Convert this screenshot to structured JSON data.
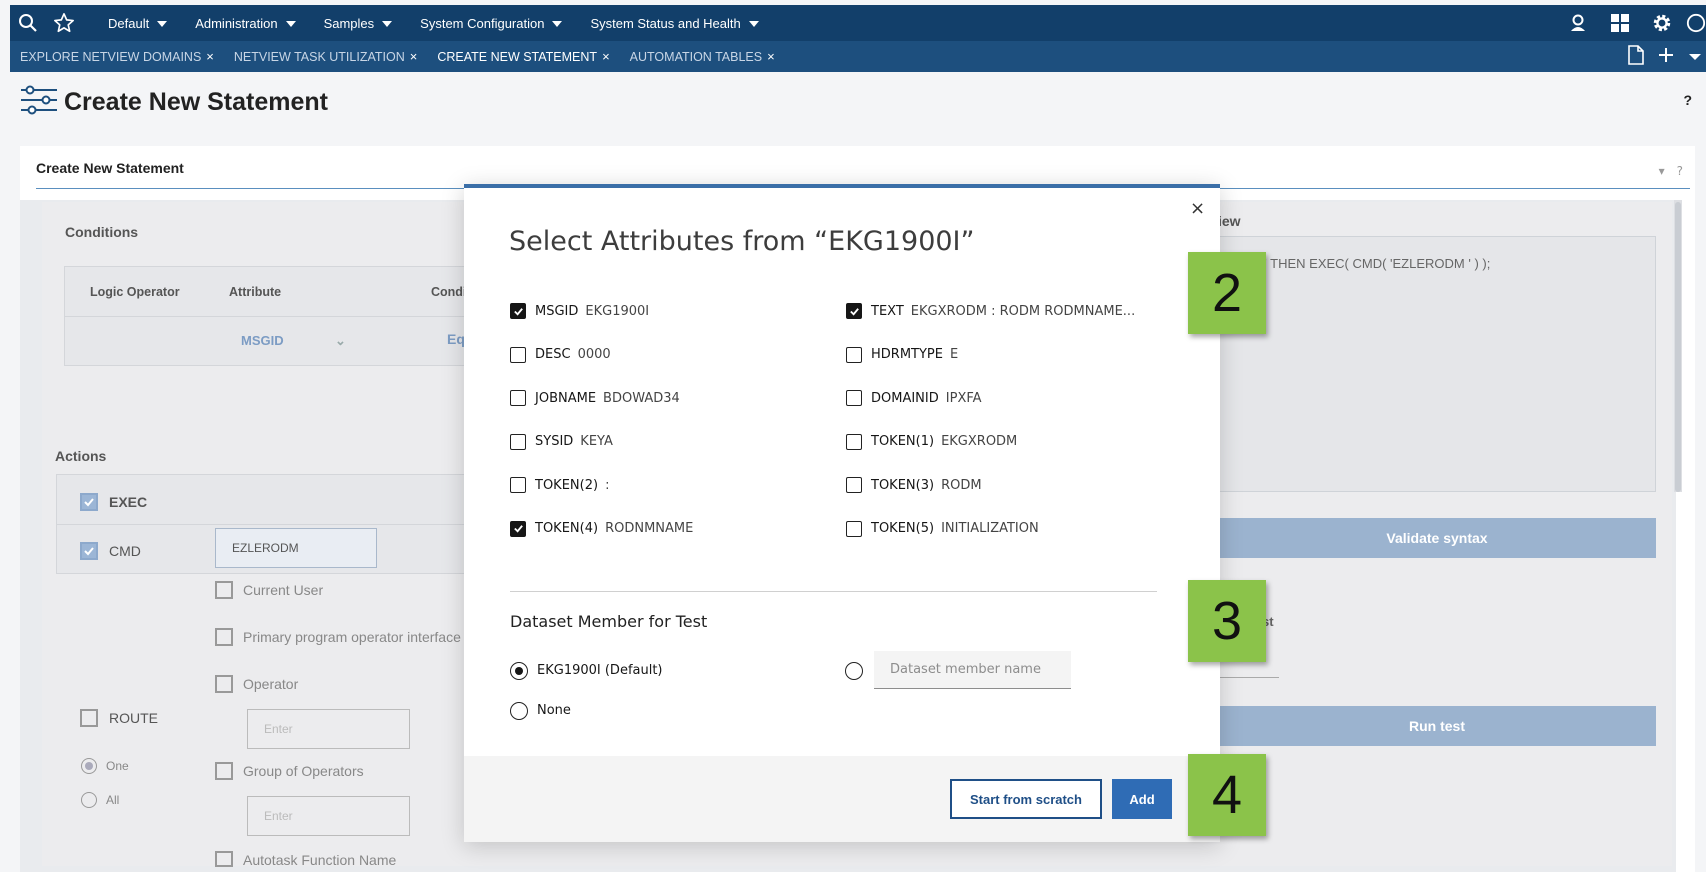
{
  "topnav": {
    "menus": [
      {
        "label": "Default"
      },
      {
        "label": "Administration"
      },
      {
        "label": "Samples"
      },
      {
        "label": "System Configuration"
      },
      {
        "label": "System Status and Health"
      }
    ]
  },
  "tabs": [
    {
      "label": "EXPLORE NETVIEW DOMAINS",
      "active": false
    },
    {
      "label": "NETVIEW TASK UTILIZATION",
      "active": false
    },
    {
      "label": "CREATE NEW STATEMENT",
      "active": true
    },
    {
      "label": "AUTOMATION TABLES",
      "active": false
    }
  ],
  "tab_close_glyph": "×",
  "page": {
    "title": "Create New Statement",
    "help": "?"
  },
  "panel": {
    "title": "Create New Statement",
    "help": "?"
  },
  "background": {
    "conditions_label": "Conditions",
    "col_logic": "Logic Operator",
    "col_attribute": "Attribute",
    "col_condition": "Condi",
    "attr_value": "MSGID",
    "cond_value": "Eq",
    "actions_label": "Actions",
    "exec": "EXEC",
    "cmd": "CMD",
    "cmd_value": "EZLERODM",
    "current_user": "Current User",
    "primary_op": "Primary program operator interface",
    "operator": "Operator",
    "route": "ROUTE",
    "enter1": "Enter",
    "one": "One",
    "all": "All",
    "group_ops": "Group of Operators",
    "enter2": "Enter",
    "autotask": "Autotask Function Name",
    "preview_label": "iew",
    "preview_text": "BI' THEN EXEC( CMD( 'EZLERODM ' ) );",
    "validate": "Validate syntax",
    "test_label": "st",
    "run_test": "Run test"
  },
  "modal": {
    "title": "Select Attributes from “EKG1900I”",
    "close": "×",
    "attributes": [
      {
        "name": "MSGID",
        "value": "EKG1900I",
        "checked": true
      },
      {
        "name": "TEXT",
        "value": "EKGXRODM : RODM RODMNAME...",
        "checked": true
      },
      {
        "name": "DESC",
        "value": "0000",
        "checked": false
      },
      {
        "name": "HDRMTYPE",
        "value": "E",
        "checked": false
      },
      {
        "name": "JOBNAME",
        "value": "BDOWAD34",
        "checked": false
      },
      {
        "name": "DOMAINID",
        "value": "IPXFA",
        "checked": false
      },
      {
        "name": "SYSID",
        "value": "KEYA",
        "checked": false
      },
      {
        "name": "TOKEN(1)",
        "value": "EKGXRODM",
        "checked": false
      },
      {
        "name": "TOKEN(2)",
        "value": ":",
        "checked": false
      },
      {
        "name": "TOKEN(3)",
        "value": "RODM",
        "checked": false
      },
      {
        "name": "TOKEN(4)",
        "value": "RODNMNAME",
        "checked": true
      },
      {
        "name": "TOKEN(5)",
        "value": "INITIALIZATION",
        "checked": false
      }
    ],
    "dataset_title": "Dataset Member for Test",
    "radio_default": "EKG1900I (Default)",
    "radio_none": "None",
    "radio_selected": "default",
    "dataset_placeholder": "Dataset member name",
    "btn_scratch": "Start from scratch",
    "btn_add": "Add"
  },
  "steps": [
    "2",
    "3",
    "4"
  ],
  "colors": {
    "nav": "#123f6a",
    "tabbar": "#1d4f7e",
    "primary": "#2f6cb5",
    "badge": "#8bc34a"
  }
}
